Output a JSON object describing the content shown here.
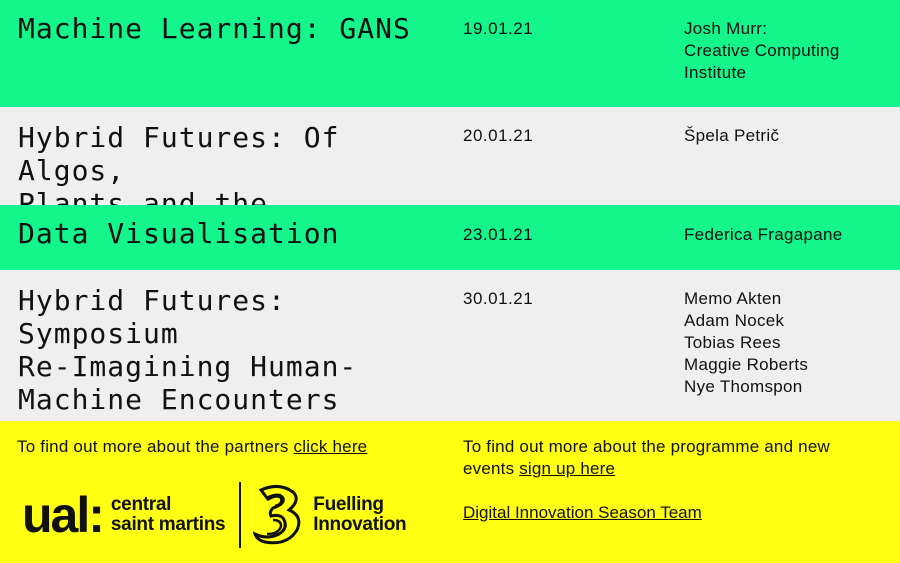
{
  "events": [
    {
      "title": "Machine Learning: GANS",
      "date": "19.01.21",
      "speakers": "Josh Murr:\nCreative Computing\nInstitute"
    },
    {
      "title": "Hybrid Futures: Of Algos,\nPlants and the Vegetariat",
      "date": "20.01.21",
      "speakers": "Špela Petrič"
    },
    {
      "title": "Data Visualisation",
      "date": "23.01.21",
      "speakers": "Federica Fragapane"
    },
    {
      "title": "Hybrid Futures: Symposium\nRe-Imagining Human-\nMachine Encounters",
      "date": "30.01.21",
      "speakers": "Memo Akten\nAdam Nocek\nTobias Rees\nMaggie Roberts\nNye Thomspon"
    }
  ],
  "footer": {
    "partners_text": "To find out more about the partners ",
    "partners_link": "click here",
    "programme_text": "To find out more about the programme and new events ",
    "programme_link": "sign up here",
    "team_link": "Digital Innovation Season Team ",
    "ual_logo": "ual:",
    "csm_logo": "central\nsaint martins",
    "three_logo_icon": "three-logo-icon",
    "fuelling_logo": "Fuelling\nInnovation"
  },
  "colors": {
    "green": "#14f58c",
    "grey": "#efefef",
    "yellow": "#ffff14"
  }
}
